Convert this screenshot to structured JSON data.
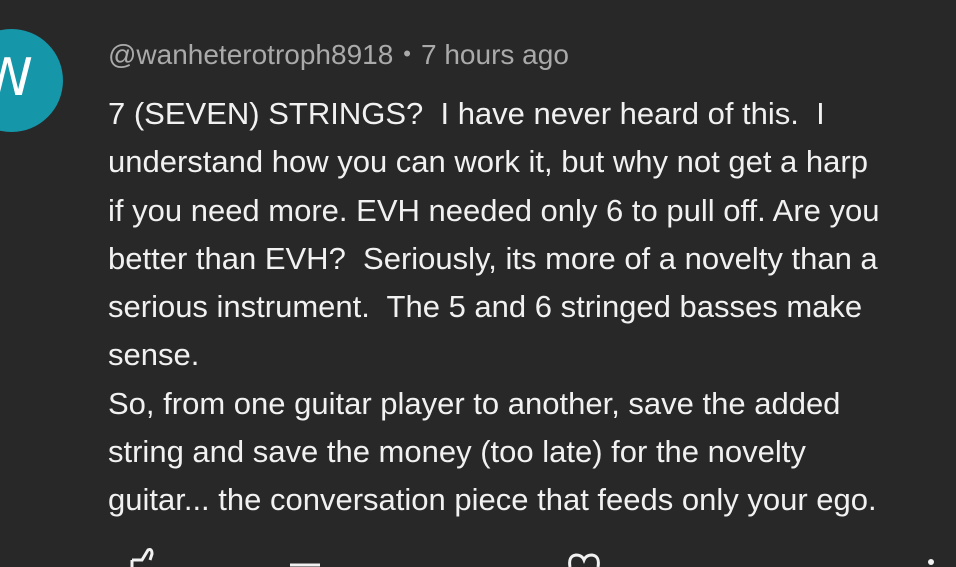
{
  "comment": {
    "avatar_letter": "W",
    "avatar_color": "#1596a9",
    "author": "@wanheterotroph8918",
    "separator": "•",
    "timestamp": "7 hours ago",
    "lines": [
      "7 (SEVEN) STRINGS?  I have never heard of this.  I",
      "understand how you can work it, but why not get a harp",
      "if you need more. EVH needed only 6 to pull off. Are you",
      "better than EVH?  Seriously, its more of a novelty than a",
      "serious instrument.  The 5 and 6 stringed basses make",
      "sense.",
      "So, from one guitar player to another, save the added",
      "string and save the money (too late) for the novelty",
      "guitar... the conversation piece that feeds only your ego."
    ]
  },
  "actions": {
    "icons": [
      "thumbs-up-icon",
      "thumbs-down-icon",
      "heart-icon",
      "more-options-icon"
    ]
  }
}
